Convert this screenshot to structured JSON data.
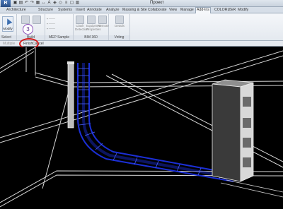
{
  "app": {
    "button_label": "R",
    "window_title": "Проект"
  },
  "tabs": [
    {
      "label": "Architecture"
    },
    {
      "label": "Structure"
    },
    {
      "label": "Systems"
    },
    {
      "label": "Insert"
    },
    {
      "label": "Annotate"
    },
    {
      "label": "Analyze"
    },
    {
      "label": "Massing & Site"
    },
    {
      "label": "Collaborate"
    },
    {
      "label": "View"
    },
    {
      "label": "Manage"
    },
    {
      "label": "Add-Ins"
    },
    {
      "label": "COLORIZER"
    },
    {
      "label": "Modify"
    }
  ],
  "ribbon": {
    "modify_label": "Modify",
    "step_number": "3",
    "panels": {
      "build": "Build",
      "mep_sample": "MEP Sample",
      "bim360": "BIM 360",
      "voting": "Voting"
    },
    "buttons": {
      "select": "Select",
      "clash": "Clash Detection",
      "equipment": "Equipment Properties",
      "remote": "Remote",
      "details": "Details"
    }
  },
  "options_bar": {
    "finish": "Finish",
    "cancel": "Cancel",
    "mode": "Multiple"
  },
  "colors": {
    "tray": "#1b2fd6",
    "highlight": "#d11b1b"
  }
}
